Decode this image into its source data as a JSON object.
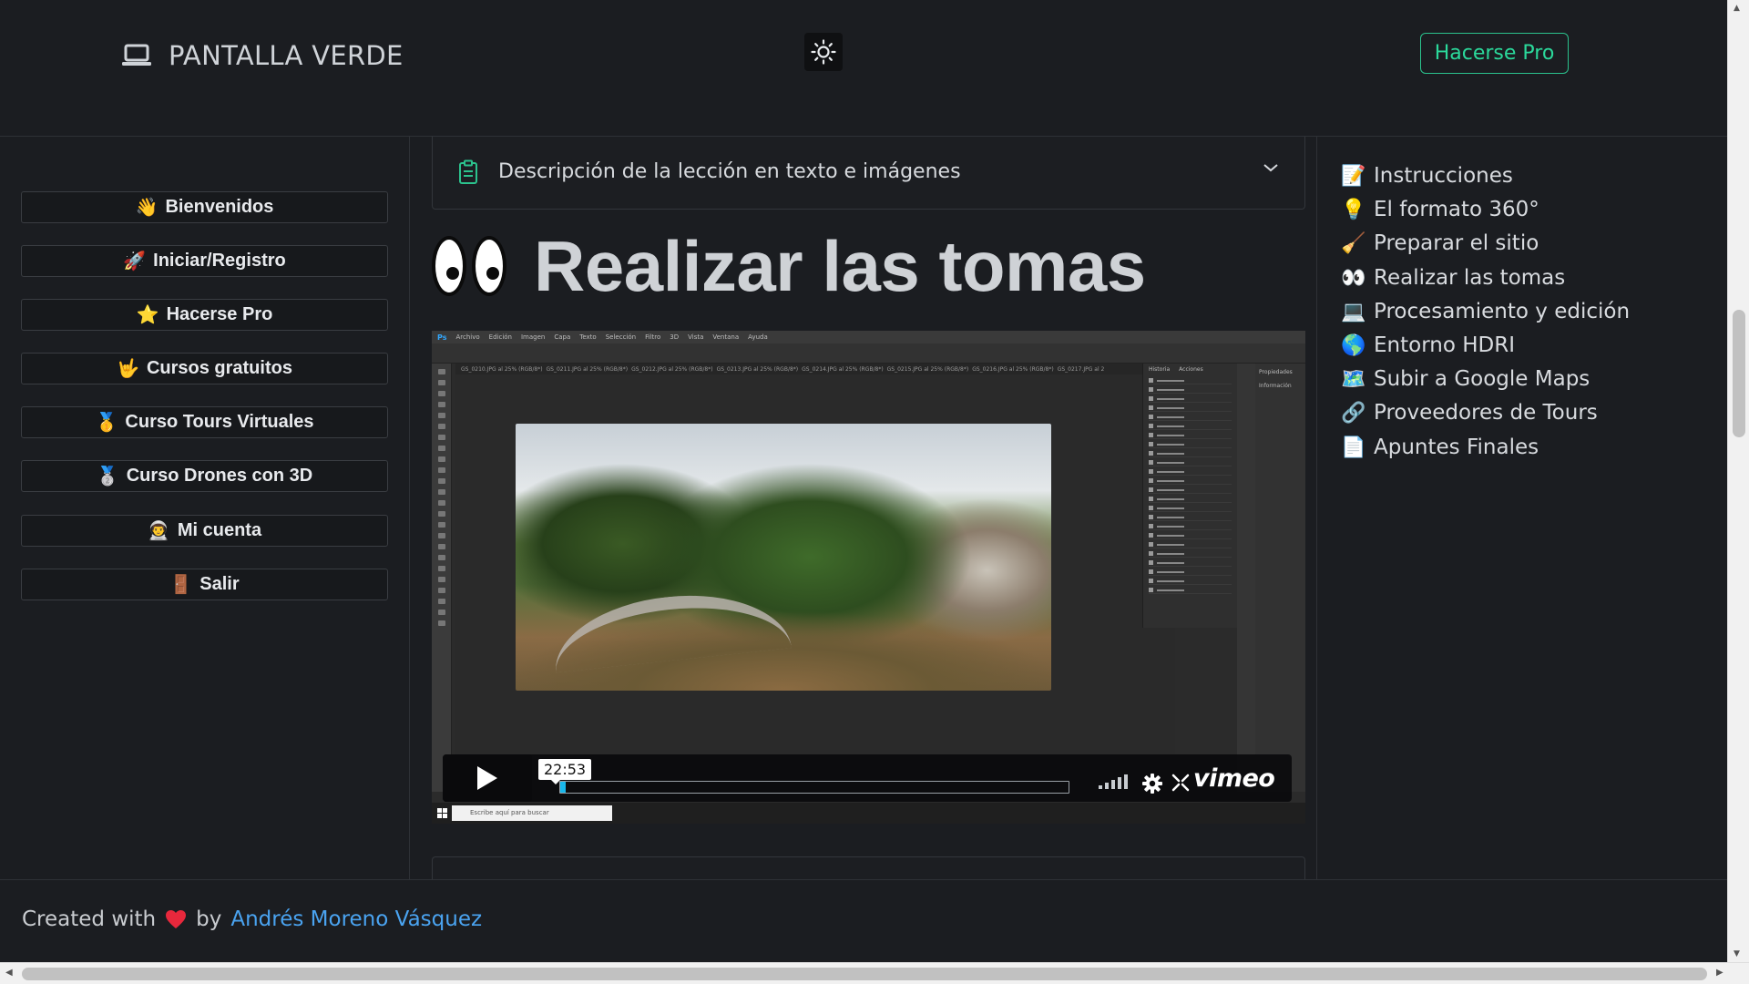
{
  "header": {
    "brand": "PANTALLA VERDE",
    "pro_button": "Hacerse Pro"
  },
  "sidebar": {
    "items": [
      {
        "emoji": "👋",
        "label": "Bienvenidos"
      },
      {
        "emoji": "🚀",
        "label": "Iniciar/Registro"
      },
      {
        "emoji": "⭐",
        "label": "Hacerse Pro"
      },
      {
        "emoji": "🤟",
        "label": "Cursos gratuitos"
      },
      {
        "emoji": "🥇",
        "label": "Curso Tours Virtuales"
      },
      {
        "emoji": "🥈",
        "label": "Curso Drones con 3D"
      },
      {
        "emoji": "👨‍🚀",
        "label": "Mi cuenta"
      },
      {
        "emoji": "🚪",
        "label": "Salir"
      }
    ]
  },
  "main": {
    "accordion_label": "Descripción de la lección en texto e imágenes",
    "lesson_title": "Realizar las tomas"
  },
  "video": {
    "time": "22:53",
    "progress_fraction": 0.01,
    "logo": "vimeo",
    "taskbar_search_placeholder": "Escribe aquí para buscar",
    "ps_menu": [
      "Archivo",
      "Edición",
      "Imagen",
      "Capa",
      "Texto",
      "Selección",
      "Filtro",
      "3D",
      "Vista",
      "Ventana",
      "Ayuda"
    ],
    "ps_tabs": [
      "GS_0210.JPG al 25% (RGB/8*)",
      "GS_0211.JPG al 25% (RGB/8*)",
      "GS_0212.JPG al 25% (RGB/8*)",
      "GS_0213.JPG al 25% (RGB/8*)",
      "GS_0214.JPG al 25% (RGB/8*)",
      "GS_0215.JPG al 25% (RGB/8*)",
      "GS_0216.JPG al 25% (RGB/8*)",
      "GS_0217.JPG al 2"
    ],
    "ps_panel_tabs": [
      "Historia",
      "Acciones"
    ],
    "ps_props": [
      "Propiedades",
      "Información"
    ]
  },
  "toc": {
    "items": [
      {
        "emoji": "📝",
        "label": "Instrucciones"
      },
      {
        "emoji": "💡",
        "label": "El formato 360°"
      },
      {
        "emoji": "🧹",
        "label": "Preparar el sitio"
      },
      {
        "emoji": "👀",
        "label": "Realizar las tomas"
      },
      {
        "emoji": "💻",
        "label": "Procesamiento y edición"
      },
      {
        "emoji": "🌎",
        "label": "Entorno HDRI"
      },
      {
        "emoji": "🗺️",
        "label": "Subir a Google Maps"
      },
      {
        "emoji": "🔗",
        "label": "Proveedores de Tours"
      },
      {
        "emoji": "📄",
        "label": "Apuntes Finales"
      }
    ]
  },
  "footer": {
    "prefix": "Created with",
    "by": "by",
    "author": "Andrés Moreno Vásquez"
  },
  "colors": {
    "background": "#1b1d21",
    "accent_green": "#2bd99b",
    "link_blue": "#4aa3f0",
    "heart": "#e8283c",
    "video_progress": "#19b7ea"
  }
}
